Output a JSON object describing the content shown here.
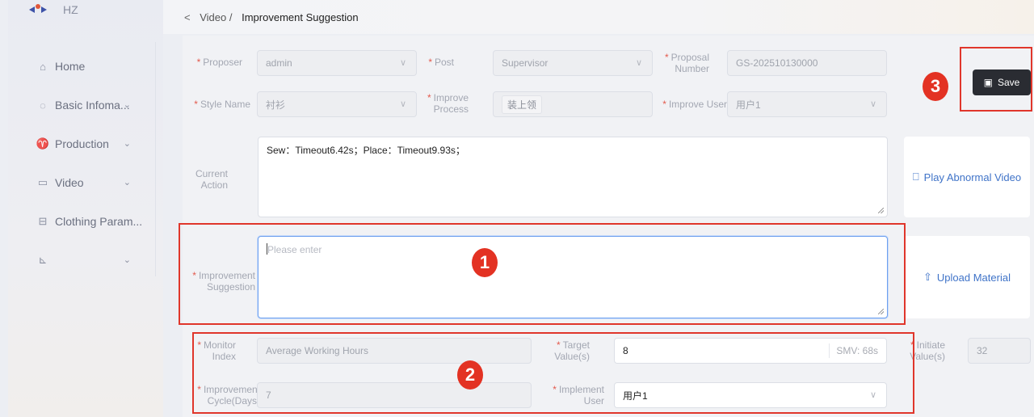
{
  "brand": {
    "name": "HZ"
  },
  "sidebar": {
    "items": [
      {
        "icon": "home-icon",
        "glyph": "⌂",
        "label": "Home",
        "chevron": false
      },
      {
        "icon": "shield-icon",
        "glyph": "◌",
        "label": "Basic Infoma...",
        "chevron": true
      },
      {
        "icon": "shirt-icon",
        "glyph": "♈",
        "label": "Production",
        "chevron": true
      },
      {
        "icon": "video-icon",
        "glyph": "▭",
        "label": "Video",
        "chevron": true
      },
      {
        "icon": "clothing-param-icon",
        "glyph": "⊟",
        "label": "Clothing Param...",
        "chevron": false
      },
      {
        "icon": "chart-icon",
        "glyph": "⊾",
        "label": "",
        "chevron": true
      }
    ]
  },
  "breadcrumb": {
    "back": "<",
    "parent": "Video",
    "separator": "/",
    "current": "Improvement Suggestion"
  },
  "form": {
    "proposer": {
      "label": "Proposer",
      "value": "admin"
    },
    "post": {
      "label": "Post",
      "value": "Supervisor"
    },
    "proposal_number": {
      "label_1": "Proposal",
      "label_2": "Number",
      "value": "GS-202510130000"
    },
    "style_name": {
      "label": "Style Name",
      "value": "衬衫"
    },
    "improve_process": {
      "label_1": "Improve",
      "label_2": "Process",
      "value": "装上领"
    },
    "improve_user": {
      "label": "Improve User",
      "value": "用户1"
    },
    "current_action": {
      "label_1": "Current",
      "label_2": "Action",
      "value": "Sew：Timeout6.42s；Place：Timeout9.93s；"
    },
    "improvement_suggestion": {
      "label_1": "Improvement",
      "label_2": "Suggestion",
      "placeholder": "Please enter"
    },
    "monitor_index": {
      "label_1": "Monitor",
      "label_2": "Index",
      "value": "Average Working Hours"
    },
    "target_value": {
      "label_1": "Target",
      "label_2": "Value(s)",
      "value": "8",
      "suffix": "SMV: 68s"
    },
    "initiate_value": {
      "label_1": "Initiate",
      "label_2": "Value(s)",
      "value": "32"
    },
    "improvement_cycle": {
      "label_1": "Improvement",
      "label_2": "Cycle(Days)",
      "value": "7"
    },
    "implement_user": {
      "label_1": "Implement",
      "label_2": "User",
      "value": "用户1"
    }
  },
  "actions": {
    "play_video": "Play Abnormal Video",
    "upload_material": "Upload Material",
    "save": "Save"
  },
  "annotations": {
    "badge_1": "1",
    "badge_2": "2",
    "badge_3": "3",
    "color": "#e0362b"
  },
  "colors": {
    "accent": "#3f73c8",
    "required": "#e35a4d",
    "save_bg": "#2a2c32"
  }
}
